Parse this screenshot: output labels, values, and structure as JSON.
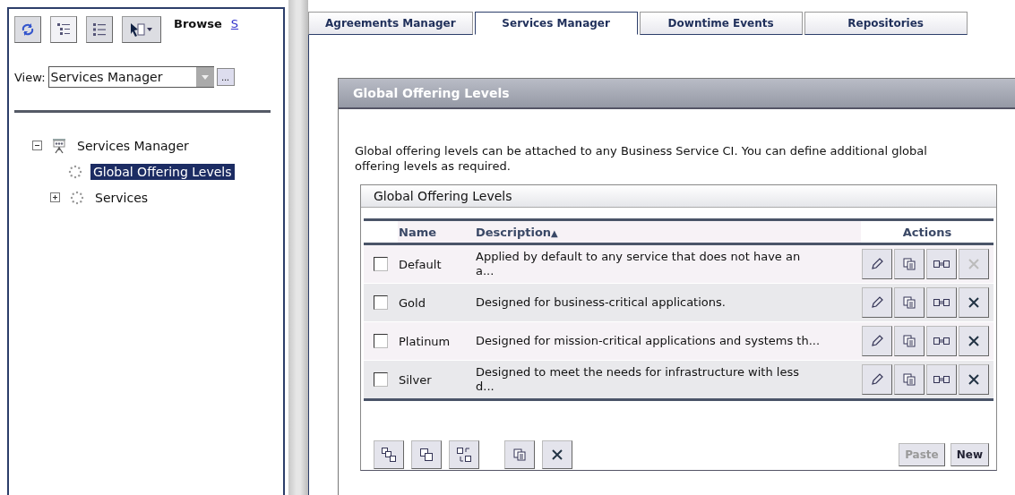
{
  "left_panel": {
    "title": "Browse",
    "link": "S",
    "view": {
      "label": "View:",
      "value": "Services Manager",
      "more": "..."
    },
    "tree": [
      {
        "label": "Services Manager",
        "kind": "board",
        "expanded": true,
        "selected": false,
        "children": [
          {
            "label": "Global Offering Levels",
            "kind": "dots",
            "selected": true
          },
          {
            "label": "Services",
            "kind": "dots",
            "expanded": false,
            "selected": false
          }
        ]
      }
    ]
  },
  "tabs": [
    {
      "label": "Agreements Manager",
      "selected": false
    },
    {
      "label": "Services Manager",
      "selected": true
    },
    {
      "label": "Downtime Events",
      "selected": false
    },
    {
      "label": "Repositories",
      "selected": false
    }
  ],
  "panel": {
    "title": "Global Offering Levels",
    "description": "Global offering levels can be attached to any Business Service CI. You can define additional global offering levels as required.",
    "table": {
      "title": "Global Offering Levels",
      "columns": [
        "Name",
        "Description",
        "Actions"
      ],
      "sort_mark": "▲",
      "rows": [
        {
          "checked": false,
          "name": "Default",
          "description": "Applied by default to any service that does not have an a...",
          "delete_disabled": true
        },
        {
          "checked": false,
          "name": "Gold",
          "description": "Designed for business-critical applications.",
          "delete_disabled": false
        },
        {
          "checked": false,
          "name": "Platinum",
          "description": "Designed for mission-critical applications and systems th...",
          "delete_disabled": false
        },
        {
          "checked": false,
          "name": "Silver",
          "description": "Designed to meet the needs for infrastructure with less d...",
          "delete_disabled": false
        }
      ]
    },
    "buttons": [
      {
        "label": "Paste",
        "disabled": true
      },
      {
        "label": "New",
        "disabled": false
      }
    ]
  }
}
